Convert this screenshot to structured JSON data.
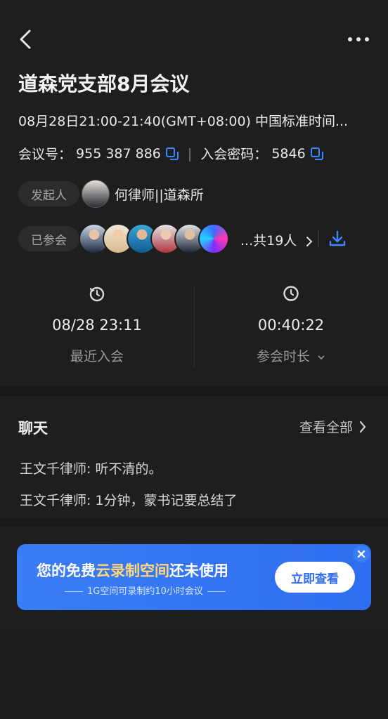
{
  "meeting": {
    "title": "道森党支部8月会议",
    "time": "08月28日21:00-21:40(GMT+08:00) 中国标准时间...",
    "id_label": "会议号：",
    "id_value": "955 387 886",
    "pwd_label": "入会密码：",
    "pwd_value": "5846"
  },
  "host": {
    "label": "发起人",
    "name": "何律师||道森所"
  },
  "joined": {
    "label": "已参会",
    "count": "...共19人"
  },
  "stats": {
    "last_join_value": "08/28 23:11",
    "last_join_label": "最近入会",
    "duration_value": "00:40:22",
    "duration_label": "参会时长"
  },
  "chat": {
    "title": "聊天",
    "view_all": "查看全部",
    "messages": [
      "王文千律师: 听不清的。",
      "王文千律师: 1分钟，蒙书记要总结了"
    ]
  },
  "banner": {
    "title_a": "您的免费",
    "title_highlight": "云录制空间",
    "title_b": "还未使用",
    "subtitle": "1G空间可录制约10小时会议",
    "button": "立即查看"
  },
  "colors": {
    "accent": "#2f6df0",
    "highlight": "#ffd87a"
  }
}
